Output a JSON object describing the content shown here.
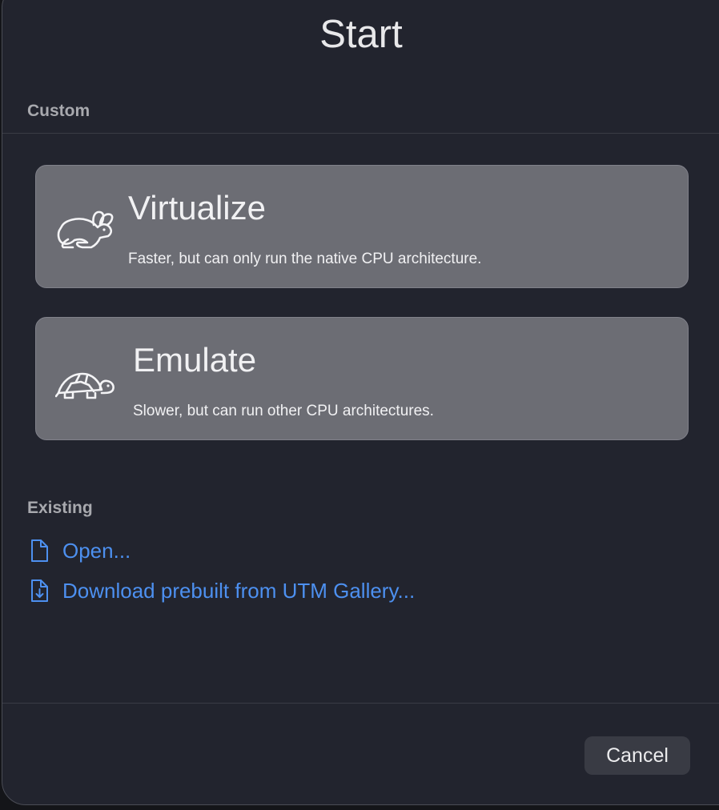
{
  "dialog": {
    "title": "Start"
  },
  "custom": {
    "label": "Custom",
    "options": [
      {
        "title": "Virtualize",
        "description": "Faster, but can only run the native CPU architecture.",
        "icon": "rabbit-icon"
      },
      {
        "title": "Emulate",
        "description": "Slower, but can run other CPU architectures.",
        "icon": "tortoise-icon"
      }
    ]
  },
  "existing": {
    "label": "Existing",
    "links": [
      {
        "label": "Open...",
        "icon": "document-icon"
      },
      {
        "label": "Download prebuilt from UTM Gallery...",
        "icon": "document-download-icon"
      }
    ]
  },
  "footer": {
    "cancel_label": "Cancel"
  },
  "colors": {
    "background": "#22242e",
    "card": "#6c6d74",
    "link": "#4d90f0",
    "button": "#393b44"
  }
}
